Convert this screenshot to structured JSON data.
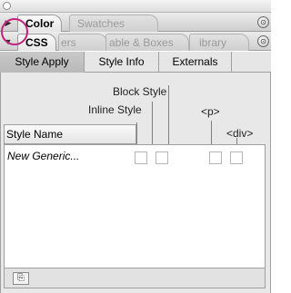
{
  "palette_group_1": {
    "disclosure_glyph": "▶",
    "tabs": [
      {
        "label": "Color",
        "active": true
      },
      {
        "label": "Swatches",
        "active": false
      }
    ],
    "menu_glyph": "⊙"
  },
  "palette_group_2": {
    "disclosure_glyph": "▼",
    "tabs": [
      {
        "label": "CSS",
        "active": true
      },
      {
        "label": "ers",
        "active": false
      },
      {
        "label": "able & Boxes",
        "active": false
      },
      {
        "label": "ibrary",
        "active": false
      }
    ],
    "menu_glyph": "⊙"
  },
  "subtabs": [
    {
      "label": "Style Apply",
      "active": true
    },
    {
      "label": "Style Info",
      "active": false
    },
    {
      "label": "Externals",
      "active": false
    }
  ],
  "column_headers": {
    "block_style": "Block Style",
    "inline_style": "Inline Style",
    "p_tag": "<p>",
    "div_tag": "<div>",
    "style_name": "Style Name"
  },
  "styles": [
    {
      "name": "New Generic...",
      "checkboxes": [
        false,
        false,
        false,
        false
      ]
    }
  ],
  "bottom_button_glyph": "⎘",
  "accent_annotation_color": "#c2227a"
}
